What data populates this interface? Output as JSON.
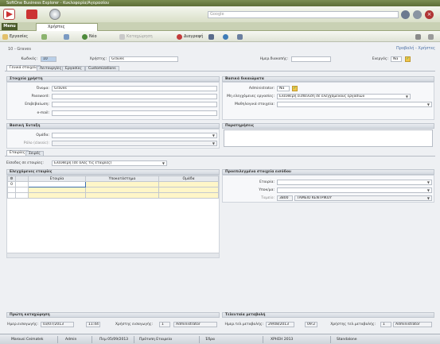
{
  "window": {
    "title": "SoftOne Business Explorer - Κυκλοφορία/Αγορασίου"
  },
  "search": {
    "placeholder": "Google"
  },
  "tabs": {
    "menu": "Menu",
    "active_tab": "Χρήστες"
  },
  "toolbar": {
    "file": "Εργασίες",
    "new": "Νέο",
    "save": "Καταχώρηση",
    "delete": "Διαγραφή"
  },
  "header": {
    "breadcrumb": "10 - Graves",
    "view_link": "Προβολή - Χρήστες"
  },
  "top_fields": {
    "code_label": "Κωδικός:",
    "code": "10",
    "user_label": "Χρήστης:",
    "user": "Graves",
    "admin_date_label": "Ημερ.διακοπής:",
    "active_label": "Ενεργός:",
    "active": "Να"
  },
  "main_tabs": [
    "Γενικά στοιχεία",
    "Λειτουργίες",
    "Εργασίες",
    "Customizations"
  ],
  "general": {
    "title": "Στοιχεία χρήστη",
    "name_label": "Όνομα:",
    "name": "Graves",
    "password_label": "Password:",
    "confirm_label": "Επιβεβαίωση:",
    "email_label": "e-mail:"
  },
  "security": {
    "title": "Βασικά δικαιώματα",
    "admin_label": "Administrator:",
    "admin": "Να",
    "restrict_label": "Μη ελεγχόμενες εργασίες:",
    "restrict": "Ελεύθερη εισπέλιση σε ελεγχόμενους εργασιών",
    "module_label": "Μαθηλογικά στοιχεία:"
  },
  "basic": {
    "title": "Βασική Ένταξη",
    "group_label": "Ομάδα:",
    "role_label": "Ρόλο (classic):"
  },
  "notes": {
    "title": "Παρατηρήσεις"
  },
  "sub_tabs": [
    "Εταιρίες",
    "Σειρές"
  ],
  "companies": {
    "access_label": "Είσοδος σε εταιρίες:",
    "access": "Ελεύθερη (σε όλες τις εταιρίες)",
    "title": "Ελεγχόμενες εταιρίες",
    "columns": [
      "Εταιρία",
      "Υποκατάστημα",
      "Ομάδα"
    ],
    "row_num": "0"
  },
  "defaults": {
    "title": "Προεπιλεγμένα στοιχεία εισόδου",
    "company_label": "Εταιρία:",
    "branch_label": "Υποκ/μα:",
    "cash_label": "Ταμείο:",
    "cash_code": "3800",
    "cash_name": "ΤΑΜΕΙΟ ΚΕΝΤΡΙΚΟΥ"
  },
  "footer": {
    "first_title": "Πρώτη καταχώρηση",
    "last_title": "Τελευταία μεταβολή",
    "insert_date_label": "Ημερ.εισαγωγής:",
    "insert_date": "03/07/2013",
    "insert_time": "11:44",
    "insert_user_label": "Χρήστης εισαγωγής:",
    "insert_user_code": "1",
    "insert_user": "Administrator",
    "mod_date_label": "Ημερ.τελ.μεταβολής:",
    "mod_date": "29/08/2013",
    "mod_time": "09:2",
    "mod_user_label": "Χρήστης τελ.μεταβολής:",
    "mod_user_code": "1",
    "mod_user": "Administrator"
  },
  "status": {
    "company": "Marousi Ceimatek",
    "user": "Admin",
    "date": "Πεμ 05/09/2013",
    "firm": "Πρότυπη Εταιρεία",
    "branch": "Έδρα",
    "year": "ΧΡΗΣΗ 2013",
    "mode": "Standalone"
  },
  "colors": {
    "title_bar": "#5d6e36",
    "accent": "#7c8e52",
    "link": "#4a6fa5"
  }
}
